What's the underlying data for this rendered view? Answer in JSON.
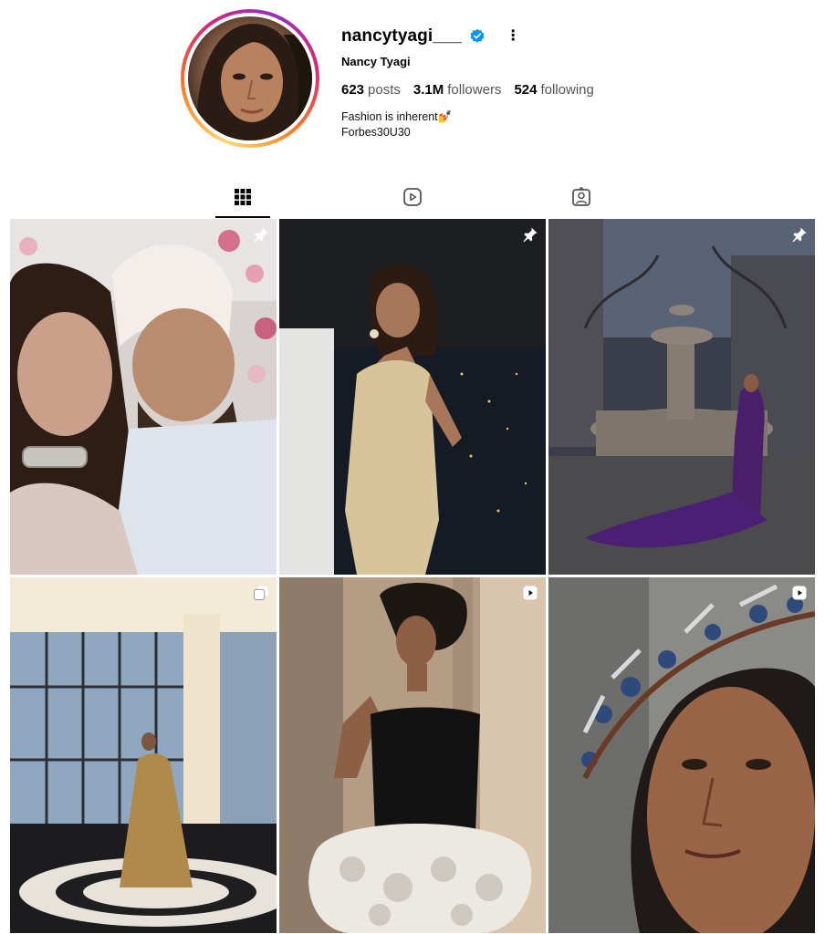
{
  "profile": {
    "username": "nancytyagi___",
    "full_name": "Nancy Tyagi",
    "verified": true,
    "stats": {
      "posts_count": "623",
      "posts_label": "posts",
      "followers_count": "3.1M",
      "followers_label": "followers",
      "following_count": "524",
      "following_label": "following"
    },
    "bio_line1": "Fashion is inherent💅",
    "bio_line2": "Forbes30U30",
    "more_icon": "⋮"
  },
  "tabs": [
    {
      "name": "posts",
      "icon": "grid-icon",
      "active": true
    },
    {
      "name": "reels",
      "icon": "reels-icon",
      "active": false
    },
    {
      "name": "tagged",
      "icon": "tagged-icon",
      "active": false
    }
  ],
  "posts": [
    {
      "badge": "pin-icon"
    },
    {
      "badge": "pin-icon"
    },
    {
      "badge": "pin-icon"
    },
    {
      "badge": "carousel-icon"
    },
    {
      "badge": "reel-icon"
    },
    {
      "badge": "reel-icon"
    }
  ],
  "colors": {
    "verified_blue": "#0095f6",
    "ring_gradient": [
      "#feda75",
      "#fa7e1e",
      "#d62976",
      "#962fbf"
    ]
  }
}
